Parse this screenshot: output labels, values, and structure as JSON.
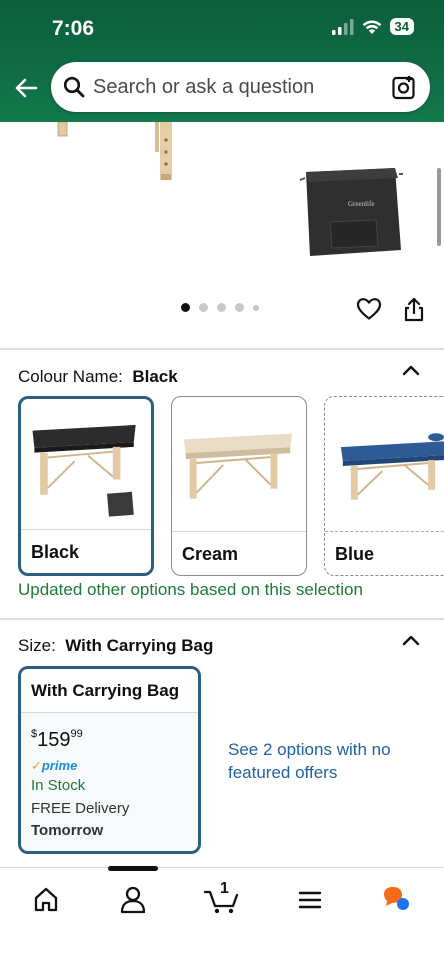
{
  "status_bar": {
    "time": "7:06",
    "battery": "34"
  },
  "search": {
    "placeholder": "Search or ask a question"
  },
  "gallery": {
    "bag_logo": "Greenlife",
    "dot_count": 5,
    "active_dot": 0
  },
  "colour": {
    "label": "Colour Name:",
    "selected": "Black",
    "options": [
      {
        "name": "Black",
        "selected": true
      },
      {
        "name": "Cream",
        "selected": false
      },
      {
        "name": "Blue",
        "selected": false
      }
    ],
    "note": "Updated other options based on this selection"
  },
  "size": {
    "label": "Size:",
    "selected": "With Carrying Bag",
    "card": {
      "title": "With Carrying Bag",
      "currency": "$",
      "price_whole": "159",
      "price_fraction": "99",
      "prime": "prime",
      "stock": "In Stock",
      "delivery": "FREE Delivery",
      "delivery_day": "Tomorrow"
    },
    "other_options": "See 2 options with no featured offers"
  },
  "nav": {
    "cart_count": "1"
  },
  "colors": {
    "header": "#0f6b45",
    "selected_border": "#2a5f82",
    "link": "#2162a1",
    "success": "#1e7b34",
    "prime": "#1a8cd8"
  }
}
